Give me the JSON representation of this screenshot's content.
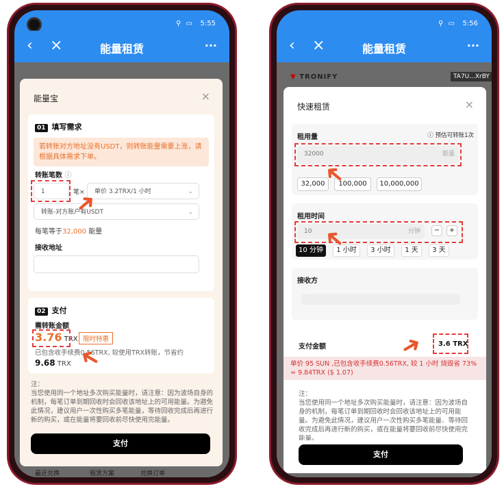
{
  "status": {
    "left_time": "5:55",
    "right_time": "5:56"
  },
  "appbar": {
    "title": "能量租赁"
  },
  "left": {
    "modal_title": "能量宝",
    "sec1_num": "01",
    "sec1_title": "填写需求",
    "warning": "若转账对方地址没有USDT，则转账能量需要上涨，请根据具体需求下单。",
    "count_label": "转账笔数",
    "count_value": "1",
    "count_unit": "笔×",
    "price_select": "单价 3.2TRX/1 小时",
    "type_select": "转账-对方账户有USDT",
    "each_prefix": "每笔等于",
    "each_value": "32,000",
    "each_suffix": "能量",
    "addr_label": "接收地址",
    "sec2_num": "02",
    "sec2_title": "支付",
    "amount_label": "需转账金额",
    "amount_value": "3.76",
    "amount_unit": "TRX",
    "promo": "限时特惠",
    "fee_text": "已包含收手续费0.56TRX, 较使用TRX转账，节省约",
    "save_value": "9.68",
    "save_unit": "TRX",
    "note": "注：\n当您使用同一个地址多次购买能量时，请注意：因为波场自身的机制，每笔订单到期回收时会回收该地址上的可用能量。为避免此情况，建议用户一次性购买多笔能量，等待回收完成后再进行新的购买，或在能量将要回收前尽快使用完能量。",
    "pay_button": "支付",
    "tabs": [
      "最近兑换",
      "租赁方案",
      "兑换订单"
    ]
  },
  "right": {
    "brand": "TRONIFY",
    "wallet_addr": "TA7U...XrBY",
    "modal_title": "快速租赁",
    "qty_label": "租用量",
    "qty_hint": "预估可转账1次",
    "qty_value": "32000",
    "qty_unit": "能量",
    "qty_chips": [
      "32,000",
      "100,000",
      "10,000,000"
    ],
    "time_label": "租用时间",
    "time_value": "10",
    "time_unit": "分钟",
    "time_minus": "−",
    "time_plus": "+",
    "time_chips": [
      "10 分钟",
      "1 小时",
      "3 小时",
      "1 天",
      "3 天"
    ],
    "recv_label": "接收方",
    "pay_label": "支付金额",
    "pay_value": "3.6 TRX",
    "banner": "单价 95 SUN ,已包含收手续费0.56TRX, 较 1 小时 烧毁省 73% ≈ 9.84TRX ($ 1.07)",
    "note": "注：\n当您使用同一个地址多次购买能量时，请注意：因为波场自身的机制，每笔订单到期回收时会回收该地址上的可用能量。为避免此情况，建议用户一次性购买多笔能量、等待回收完成后再进行新的购买，或在能量将要回收前尽快使用完能量。",
    "pay_button": "支付"
  },
  "colors": {
    "brand_blue": "#2d8cf0",
    "accent_orange": "#e8702a",
    "highlight_red": "#e23b3b"
  }
}
